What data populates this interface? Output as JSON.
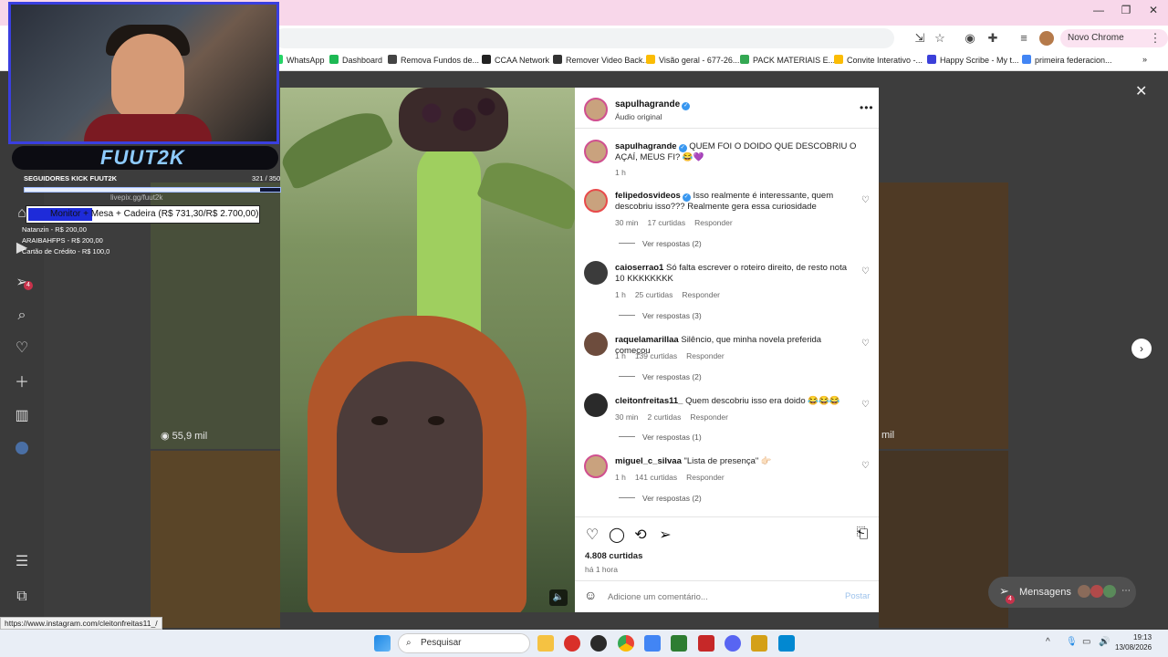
{
  "browser": {
    "new_chrome_label": "Novo Chrome disponível",
    "bookmarks": [
      {
        "label": "WhatsApp",
        "color": "#25d366"
      },
      {
        "label": "Dashboard",
        "color": "#1db954"
      },
      {
        "label": "Remova Fundos de...",
        "color": "#444444"
      },
      {
        "label": "CCAA Network",
        "color": "#222222"
      },
      {
        "label": "Remover Video Back...",
        "color": "#333333"
      },
      {
        "label": "Visão geral - 677-26...",
        "color": "#fbbc04"
      },
      {
        "label": "PACK MATERIAIS E...",
        "color": "#34a853"
      },
      {
        "label": "Convite Interativo -...",
        "color": "#fbbc04"
      },
      {
        "label": "Happy Scribe - My t...",
        "color": "#3b3fd9"
      },
      {
        "label": "primeira federacion...",
        "color": "#4285f4"
      }
    ]
  },
  "overlay": {
    "brand": "FUUT2K",
    "followers_label": "SEGUIDORES KICK FUUT2K",
    "followers_count": "321 / 350",
    "followers_progress": 0.92,
    "livepix": "livepix.gg/fuut2k",
    "goal_text": "Monitor + Mesa + Cadeira (R$ 731,30/R$ 2.700,00)",
    "donors": [
      "Natanzin - R$ 200,00",
      "ARAIBAHFPS - R$ 200,00",
      "Cartão de Crédito - R$ 100,0"
    ]
  },
  "sidebar": {
    "notification_count": "4"
  },
  "grid": {
    "views_left": "55,9 mil",
    "views_right": "mil"
  },
  "post": {
    "author": "sapulhagrande",
    "audio": "Áudio original",
    "caption_user": "sapulhagrande",
    "caption_text": "QUEM FOI O DOIDO QUE DESCOBRIU O AÇAÍ, MEUS FI? 😂💜",
    "caption_time": "1 h",
    "likes": "4.808 curtidas",
    "posted": "há 1 hora",
    "add_comment_placeholder": "Adicione um comentário...",
    "post_label": "Postar"
  },
  "comments": [
    {
      "user": "felipedosvideos",
      "verified": true,
      "text": "Isso realmente é interessante, quem descobriu isso??? Realmente gera essa curiosidade",
      "time": "30 min",
      "likes": "17 curtidas",
      "reply": "Responder",
      "view_replies": "Ver respostas (2)"
    },
    {
      "user": "caioserrao1",
      "verified": false,
      "text": "Só falta escrever o roteiro direito, de resto nota 10 KKKKKKKK",
      "time": "1 h",
      "likes": "25 curtidas",
      "reply": "Responder",
      "view_replies": "Ver respostas (3)"
    },
    {
      "user": "raquelamarillaa",
      "verified": false,
      "text": "Silêncio, que minha novela preferida começou",
      "time": "1 h",
      "likes": "139 curtidas",
      "reply": "Responder",
      "view_replies": "Ver respostas (2)"
    },
    {
      "user": "cleitonfreitas11_",
      "verified": false,
      "text": "Quem descobriu isso era doido 😂😂😂",
      "time": "30 min",
      "likes": "2 curtidas",
      "reply": "Responder",
      "view_replies": "Ver respostas (1)"
    },
    {
      "user": "miguel_c_silvaa",
      "verified": false,
      "text": "\"Lista de presença\" 👉🏻",
      "time": "1 h",
      "likes": "141 curtidas",
      "reply": "Responder",
      "view_replies": "Ver respostas (2)"
    }
  ],
  "messages_label": "Mensagens",
  "messages_badge": "4",
  "status_url": "https://www.instagram.com/cleitonfreitas11_/",
  "taskbar": {
    "search_label": "Pesquisar",
    "time": "19:13",
    "date": "13/08/2026"
  }
}
